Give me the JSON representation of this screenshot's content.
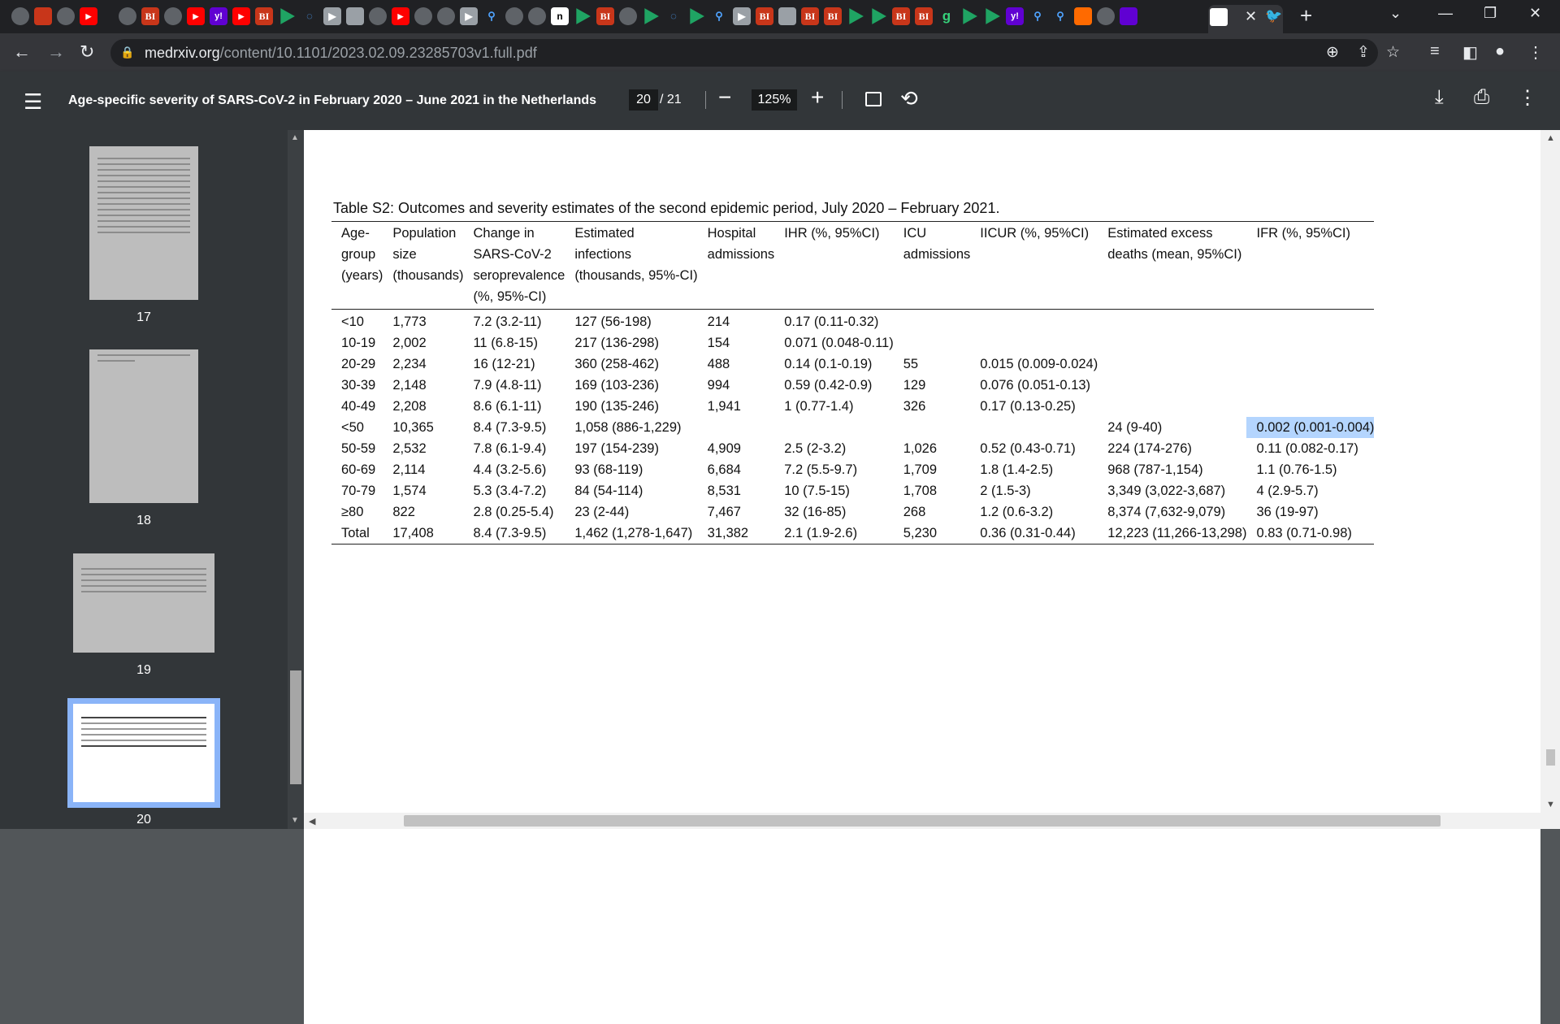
{
  "browser": {
    "url_host": "medrxiv.org",
    "url_path": "/content/10.1101/2023.02.09.23285703v1.full.pdf"
  },
  "icons": {
    "back": "arrow-left-icon",
    "forward": "arrow-right-icon",
    "reload": "reload-icon",
    "lock": "lock-icon",
    "zoom": "zoom-icon",
    "share": "share-icon",
    "star": "star-icon",
    "menu": "hamburger-icon",
    "download": "download-icon",
    "print": "print-icon",
    "more": "more-vert-icon"
  },
  "pdf": {
    "title": "Age-specific severity of SARS-CoV-2 in February 2020 – June 2021 in the Netherlands",
    "current_page": "20",
    "total_pages": "/ 21",
    "zoom": "125%"
  },
  "thumbnails": [
    {
      "label": "17"
    },
    {
      "label": "18"
    },
    {
      "label": "19"
    },
    {
      "label": "20"
    }
  ],
  "table": {
    "caption": "Table S2: Outcomes and severity estimates of the second epidemic period, July 2020 – February 2021.",
    "headers": [
      [
        "Age-",
        "group",
        "(years)",
        ""
      ],
      [
        "Population",
        "size",
        "(thousands)",
        ""
      ],
      [
        "Change in",
        "SARS-CoV-2",
        "seroprevalence",
        "(%, 95%-CI)"
      ],
      [
        "Estimated",
        "infections",
        "(thousands, 95%-CI)",
        ""
      ],
      [
        "Hospital",
        "admissions",
        "",
        ""
      ],
      [
        "IHR (%, 95%CI)",
        "",
        "",
        ""
      ],
      [
        "ICU",
        "admissions",
        "",
        ""
      ],
      [
        "IICUR (%, 95%CI)",
        "",
        "",
        ""
      ],
      [
        "Estimated excess",
        "deaths (mean, 95%CI)",
        "",
        ""
      ],
      [
        "IFR (%, 95%CI)",
        "",
        "",
        ""
      ]
    ],
    "rows": [
      [
        "<10",
        "1,773",
        "7.2 (3.2-11)",
        "127 (56-198)",
        "214",
        "0.17 (0.11-0.32)",
        "",
        "",
        "",
        ""
      ],
      [
        "10-19",
        "2,002",
        "11 (6.8-15)",
        "217 (136-298)",
        "154",
        "0.071 (0.048-0.11)",
        "",
        "",
        "",
        ""
      ],
      [
        "20-29",
        "2,234",
        "16 (12-21)",
        "360 (258-462)",
        "488",
        "0.14 (0.1-0.19)",
        "55",
        "0.015 (0.009-0.024)",
        "",
        ""
      ],
      [
        "30-39",
        "2,148",
        "7.9 (4.8-11)",
        "169 (103-236)",
        "994",
        "0.59 (0.42-0.9)",
        "129",
        "0.076 (0.051-0.13)",
        "",
        ""
      ],
      [
        "40-49",
        "2,208",
        "8.6 (6.1-11)",
        "190 (135-246)",
        "1,941",
        "1 (0.77-1.4)",
        "326",
        "0.17 (0.13-0.25)",
        "",
        ""
      ],
      [
        "<50",
        "10,365",
        "8.4 (7.3-9.5)",
        "1,058 (886-1,229)",
        "",
        "",
        "",
        "",
        "24 (9-40)",
        "0.002 (0.001-0.004)"
      ],
      [
        "50-59",
        "2,532",
        "7.8 (6.1-9.4)",
        "197 (154-239)",
        "4,909",
        "2.5 (2-3.2)",
        "1,026",
        "0.52 (0.43-0.71)",
        "224 (174-276)",
        "0.11 (0.082-0.17)"
      ],
      [
        "60-69",
        "2,114",
        "4.4 (3.2-5.6)",
        "93 (68-119)",
        "6,684",
        "7.2 (5.5-9.7)",
        "1,709",
        "1.8 (1.4-2.5)",
        "968 (787-1,154)",
        "1.1 (0.76-1.5)"
      ],
      [
        "70-79",
        "1,574",
        "5.3 (3.4-7.2)",
        "84 (54-114)",
        "8,531",
        "10 (7.5-15)",
        "1,708",
        "2 (1.5-3)",
        "3,349 (3,022-3,687)",
        "4 (2.9-5.7)"
      ],
      [
        "≥80",
        "822",
        "2.8 (0.25-5.4)",
        "23 (2-44)",
        "7,467",
        "32 (16-85)",
        "268",
        "1.2 (0.6-3.2)",
        "8,374 (7,632-9,079)",
        "36 (19-97)"
      ],
      [
        "Total",
        "17,408",
        "8.4 (7.3-9.5)",
        "1,462 (1,278-1,647)",
        "31,382",
        "2.1 (1.9-2.6)",
        "5,230",
        "0.36 (0.31-0.44)",
        "12,223 (11,266-13,298)",
        "0.83 (0.71-0.98)"
      ]
    ],
    "highlighted_cell": "0.002 (0.001-0.004)"
  }
}
